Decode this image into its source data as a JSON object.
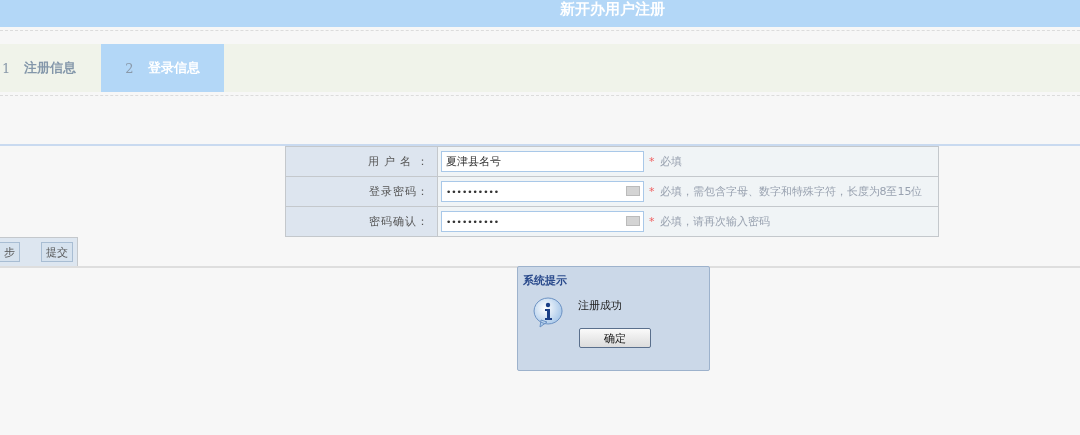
{
  "header": {
    "title": "新开办用户注册"
  },
  "steps": [
    {
      "number": "1",
      "label": "注册信息",
      "selected": false
    },
    {
      "number": "2",
      "label": "登录信息",
      "selected": true
    }
  ],
  "form": {
    "rows": [
      {
        "label": "用 户 名 ：",
        "value": "夏津县名号",
        "kind": "text",
        "required_mark": "*",
        "hint": "必填"
      },
      {
        "label": "登录密码：",
        "value": "••••••••••",
        "kind": "password",
        "required_mark": "*",
        "hint": "必填，需包含字母、数字和特殊字符，长度为8至15位"
      },
      {
        "label": "密码确认：",
        "value": "••••••••••",
        "kind": "password",
        "required_mark": "*",
        "hint": "必填，请再次输入密码"
      }
    ]
  },
  "buttons": [
    "步",
    "提交"
  ],
  "dialog": {
    "title": "系统提示",
    "message": "注册成功",
    "button": "确定"
  }
}
